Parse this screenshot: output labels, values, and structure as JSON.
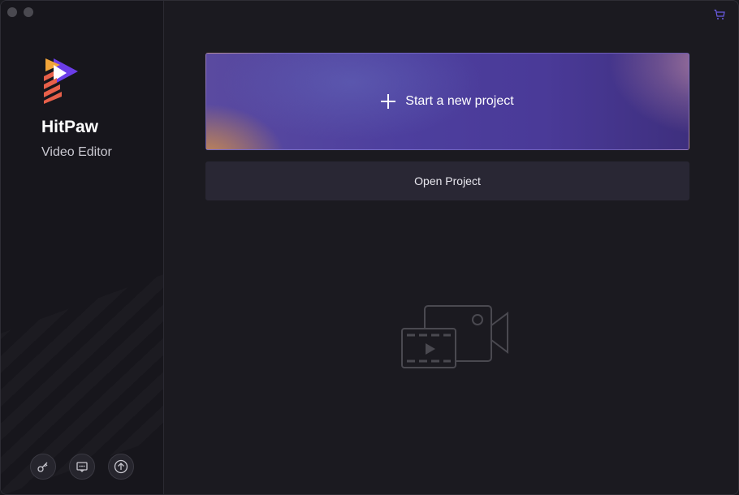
{
  "app": {
    "brand_name": "HitPaw",
    "product_name": "Video Editor"
  },
  "main": {
    "new_project_label": "Start a new project",
    "open_project_label": "Open Project"
  },
  "sidebar": {
    "buttons": [
      {
        "icon": "key-icon"
      },
      {
        "icon": "feedback-icon"
      },
      {
        "icon": "upgrade-arrow-icon"
      }
    ]
  },
  "header": {
    "cart_icon": "cart-icon"
  },
  "colors": {
    "accent": "#5a4aa0",
    "cart_icon": "#6b5ce7",
    "background": "#1b1a20",
    "sidebar": "#17161c"
  }
}
